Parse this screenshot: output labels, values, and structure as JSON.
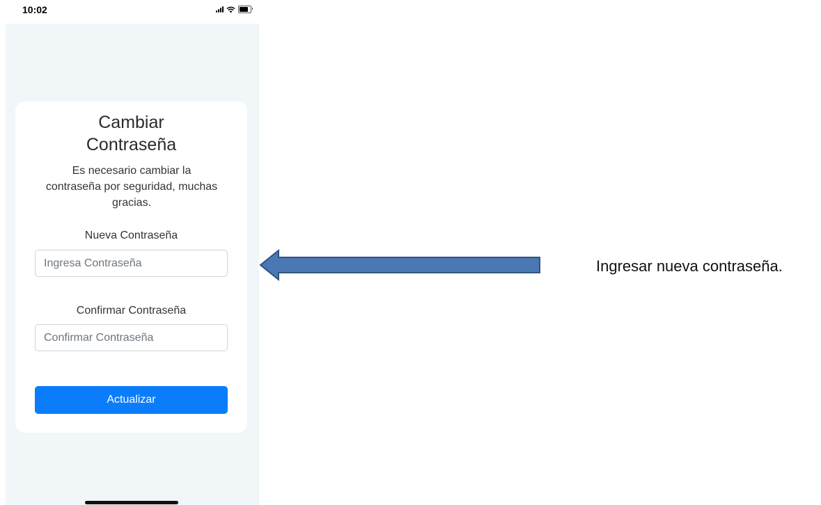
{
  "status_bar": {
    "time": "10:02",
    "icons": [
      "signal-icon",
      "wifi-icon",
      "battery-icon"
    ]
  },
  "form": {
    "title_line1": "Cambiar",
    "title_line2": "Contraseña",
    "description": "Es necesario cambiar la contraseña por seguridad, muchas gracias.",
    "new_password": {
      "label": "Nueva Contraseña",
      "placeholder": "Ingresa Contraseña",
      "value": ""
    },
    "confirm_password": {
      "label": "Confirmar Contraseña",
      "placeholder": "Confirmar Contraseña",
      "value": ""
    },
    "submit_label": "Actualizar"
  },
  "annotation": {
    "text": "Ingresar nueva contraseña.",
    "arrow_color": "#4a78b4",
    "arrow_border_color": "#2f5480"
  },
  "colors": {
    "accent": "#0b7dfb",
    "screen_background": "#f1f6f9",
    "card_background": "#ffffff"
  }
}
